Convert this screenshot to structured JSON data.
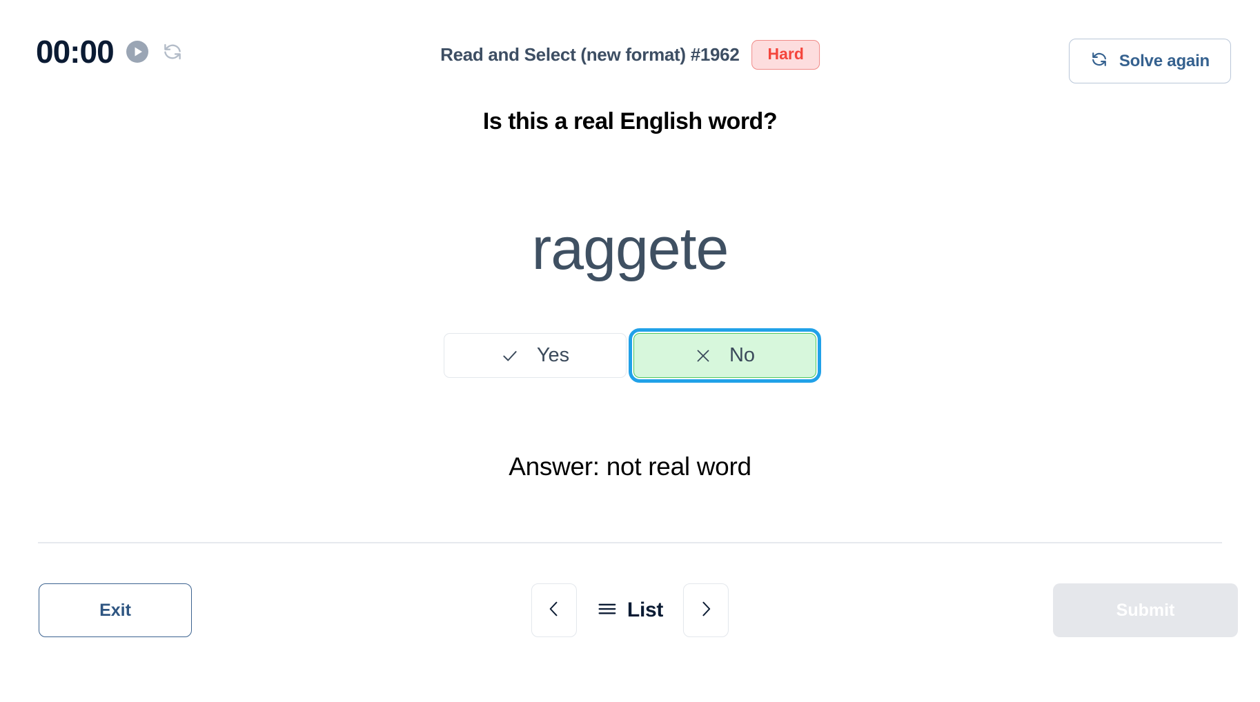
{
  "header": {
    "timer": "00:00",
    "play_icon": "play-circle-icon",
    "reload_icon": "reload-icon",
    "exercise_title": "Read and Select (new format) #1962",
    "difficulty_badge": "Hard",
    "solve_again_label": "Solve again",
    "solve_again_icon": "refresh-icon"
  },
  "main": {
    "question": "Is this a real English word?",
    "word": "raggete",
    "choices": [
      {
        "label": "Yes",
        "icon": "check-icon",
        "selected": false
      },
      {
        "label": "No",
        "icon": "close-icon",
        "selected": true
      }
    ],
    "answer": "Answer: not real word"
  },
  "footer": {
    "exit_label": "Exit",
    "prev_icon": "chevron-left-icon",
    "list_icon": "hamburger-icon",
    "list_label": "List",
    "next_icon": "chevron-right-icon",
    "submit_label": "Submit",
    "submit_disabled": true
  },
  "colors": {
    "timer": "#0b1b33",
    "title": "#3d4e63",
    "badge_text": "#f4453c",
    "badge_bg": "#fdddde",
    "badge_border": "#f08b88",
    "accent_blue": "#35618f",
    "word": "#3f5062",
    "selected_bg": "#d7f7dc",
    "selected_border": "#4fc85f",
    "focus_ring": "#21a1e8",
    "submit_disabled_bg": "#e5e7eb"
  }
}
